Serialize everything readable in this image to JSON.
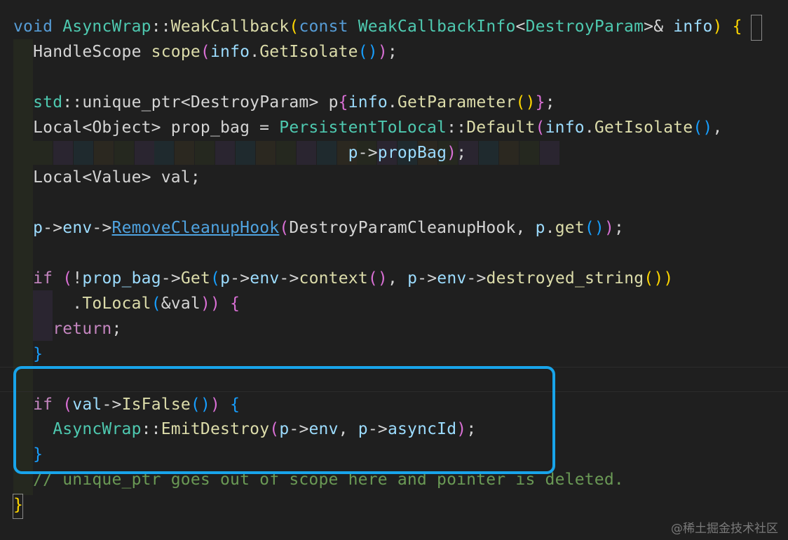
{
  "colors": {
    "background": "#1f1f1f",
    "keyword": "#569cd6",
    "control_keyword": "#c586c0",
    "function": "#dcdcaa",
    "type": "#4ec9b0",
    "variable": "#9cdcfe",
    "plain": "#d4d4d4",
    "comment": "#6a9955",
    "bracket_gold": "#ffd700",
    "bracket_purple": "#da70d6",
    "bracket_blue": "#179fff",
    "link": "#4fa3e0",
    "highlight_box": "#18a4ea",
    "watermark": "#7a7a7a"
  },
  "code": {
    "lines": [
      {
        "tokens": [
          {
            "text": "void ",
            "color": "keyword"
          },
          {
            "text": "AsyncWrap",
            "color": "type"
          },
          {
            "text": "::",
            "color": "plain"
          },
          {
            "text": "WeakCallback",
            "color": "function"
          },
          {
            "text": "(",
            "color": "bracket_gold"
          },
          {
            "text": "const ",
            "color": "keyword"
          },
          {
            "text": "WeakCallbackInfo",
            "color": "type"
          },
          {
            "text": "<",
            "color": "plain"
          },
          {
            "text": "DestroyParam",
            "color": "type"
          },
          {
            "text": ">& ",
            "color": "plain"
          },
          {
            "text": "info",
            "color": "variable"
          },
          {
            "text": ") ",
            "color": "bracket_gold"
          },
          {
            "text": "{",
            "color": "bracket_gold"
          }
        ]
      },
      {
        "tokens": [
          {
            "text": "  HandleScope ",
            "color": "plain"
          },
          {
            "text": "scope",
            "color": "function"
          },
          {
            "text": "(",
            "color": "bracket_purple"
          },
          {
            "text": "info",
            "color": "variable"
          },
          {
            "text": ".",
            "color": "plain"
          },
          {
            "text": "GetIsolate",
            "color": "function"
          },
          {
            "text": "()",
            "color": "bracket_blue"
          },
          {
            "text": ")",
            "color": "bracket_purple"
          },
          {
            "text": ";",
            "color": "plain"
          }
        ]
      },
      {
        "tokens": []
      },
      {
        "tokens": [
          {
            "text": "  std",
            "color": "type"
          },
          {
            "text": "::",
            "color": "plain"
          },
          {
            "text": "unique_ptr",
            "color": "plain"
          },
          {
            "text": "<DestroyParam> ",
            "color": "plain"
          },
          {
            "text": "p",
            "color": "plain"
          },
          {
            "text": "{",
            "color": "bracket_purple"
          },
          {
            "text": "info",
            "color": "variable"
          },
          {
            "text": ".",
            "color": "plain"
          },
          {
            "text": "GetParameter",
            "color": "function"
          },
          {
            "text": "()",
            "color": "bracket_gold"
          },
          {
            "text": "}",
            "color": "bracket_purple"
          },
          {
            "text": ";",
            "color": "plain"
          }
        ]
      },
      {
        "tokens": [
          {
            "text": "  Local<Object> prop_bag = ",
            "color": "plain"
          },
          {
            "text": "PersistentToLocal",
            "color": "type"
          },
          {
            "text": "::",
            "color": "plain"
          },
          {
            "text": "Default",
            "color": "function"
          },
          {
            "text": "(",
            "color": "bracket_purple"
          },
          {
            "text": "info",
            "color": "variable"
          },
          {
            "text": ".",
            "color": "plain"
          },
          {
            "text": "GetIsolate",
            "color": "function"
          },
          {
            "text": "()",
            "color": "bracket_blue"
          },
          {
            "text": ",",
            "color": "plain"
          }
        ]
      },
      {
        "tokens": [
          {
            "text": "                                  ",
            "color": "plain"
          },
          {
            "text": "p",
            "color": "variable"
          },
          {
            "text": "->",
            "color": "plain"
          },
          {
            "text": "propBag",
            "color": "variable"
          },
          {
            "text": ")",
            "color": "bracket_purple"
          },
          {
            "text": ";",
            "color": "plain"
          }
        ]
      },
      {
        "tokens": [
          {
            "text": "  Local<Value> val;",
            "color": "plain"
          }
        ]
      },
      {
        "tokens": []
      },
      {
        "tokens": [
          {
            "text": "  p",
            "color": "variable"
          },
          {
            "text": "->",
            "color": "plain"
          },
          {
            "text": "env",
            "color": "variable"
          },
          {
            "text": "->",
            "color": "plain"
          },
          {
            "text": "RemoveCleanupHook",
            "color": "link",
            "underline": true
          },
          {
            "text": "(",
            "color": "bracket_purple"
          },
          {
            "text": "DestroyParamCleanupHook, ",
            "color": "plain"
          },
          {
            "text": "p",
            "color": "variable"
          },
          {
            "text": ".",
            "color": "plain"
          },
          {
            "text": "get",
            "color": "function"
          },
          {
            "text": "()",
            "color": "bracket_blue"
          },
          {
            "text": ")",
            "color": "bracket_purple"
          },
          {
            "text": ";",
            "color": "plain"
          }
        ]
      },
      {
        "tokens": []
      },
      {
        "tokens": [
          {
            "text": "  if ",
            "color": "control_keyword"
          },
          {
            "text": "(",
            "color": "bracket_purple"
          },
          {
            "text": "!",
            "color": "plain"
          },
          {
            "text": "prop_bag",
            "color": "variable"
          },
          {
            "text": "->",
            "color": "plain"
          },
          {
            "text": "Get",
            "color": "function"
          },
          {
            "text": "(",
            "color": "bracket_blue"
          },
          {
            "text": "p",
            "color": "variable"
          },
          {
            "text": "->",
            "color": "plain"
          },
          {
            "text": "env",
            "color": "variable"
          },
          {
            "text": "->",
            "color": "plain"
          },
          {
            "text": "context",
            "color": "function"
          },
          {
            "text": "()",
            "color": "bracket_purple"
          },
          {
            "text": ", ",
            "color": "plain"
          },
          {
            "text": "p",
            "color": "variable"
          },
          {
            "text": "->",
            "color": "plain"
          },
          {
            "text": "env",
            "color": "variable"
          },
          {
            "text": "->",
            "color": "plain"
          },
          {
            "text": "destroyed_string",
            "color": "function"
          },
          {
            "text": "())",
            "color": "bracket_gold"
          }
        ]
      },
      {
        "tokens": [
          {
            "text": "      .",
            "color": "plain"
          },
          {
            "text": "ToLocal",
            "color": "function"
          },
          {
            "text": "(",
            "color": "bracket_blue"
          },
          {
            "text": "&val",
            "color": "plain"
          },
          {
            "text": "))",
            "color": "bracket_purple"
          },
          {
            "text": " {",
            "color": "bracket_purple"
          }
        ]
      },
      {
        "tokens": [
          {
            "text": "    return",
            "color": "control_keyword"
          },
          {
            "text": ";",
            "color": "plain"
          }
        ]
      },
      {
        "tokens": [
          {
            "text": "  }",
            "color": "bracket_blue"
          }
        ]
      },
      {
        "tokens": []
      },
      {
        "tokens": [
          {
            "text": "  if ",
            "color": "control_keyword"
          },
          {
            "text": "(",
            "color": "bracket_purple"
          },
          {
            "text": "val",
            "color": "variable"
          },
          {
            "text": "->",
            "color": "plain"
          },
          {
            "text": "IsFalse",
            "color": "function"
          },
          {
            "text": "()",
            "color": "bracket_blue"
          },
          {
            "text": ")",
            "color": "bracket_purple"
          },
          {
            "text": " {",
            "color": "bracket_blue"
          }
        ]
      },
      {
        "tokens": [
          {
            "text": "    AsyncWrap",
            "color": "type"
          },
          {
            "text": "::",
            "color": "plain"
          },
          {
            "text": "EmitDestroy",
            "color": "function"
          },
          {
            "text": "(",
            "color": "bracket_purple"
          },
          {
            "text": "p",
            "color": "variable"
          },
          {
            "text": "->",
            "color": "plain"
          },
          {
            "text": "env",
            "color": "variable"
          },
          {
            "text": ", ",
            "color": "plain"
          },
          {
            "text": "p",
            "color": "variable"
          },
          {
            "text": "->",
            "color": "plain"
          },
          {
            "text": "asyncId",
            "color": "variable"
          },
          {
            "text": ")",
            "color": "bracket_purple"
          },
          {
            "text": ";",
            "color": "plain"
          }
        ]
      },
      {
        "tokens": [
          {
            "text": "  }",
            "color": "bracket_blue"
          }
        ]
      },
      {
        "tokens": [
          {
            "text": "  // unique_ptr goes out of scope here and pointer is deleted.",
            "color": "comment"
          }
        ]
      },
      {
        "tokens": [
          {
            "text": "}",
            "color": "bracket_gold"
          }
        ]
      }
    ]
  },
  "watermark": {
    "text": "@稀土掘金技术社区"
  }
}
